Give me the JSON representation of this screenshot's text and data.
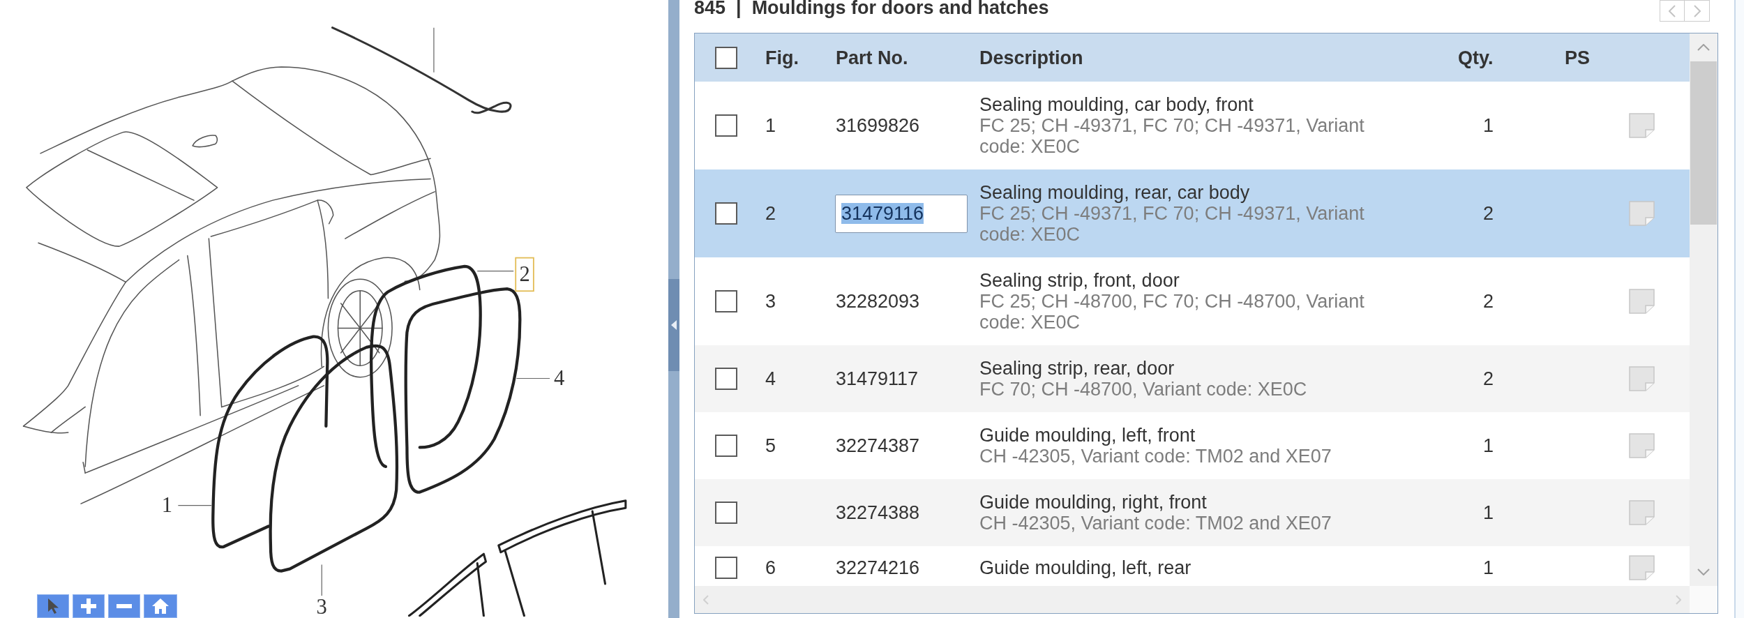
{
  "drawing": {
    "callouts": [
      {
        "label": "1",
        "selected": false
      },
      {
        "label": "2",
        "selected": true
      },
      {
        "label": "3",
        "selected": false
      },
      {
        "label": "4",
        "selected": false
      }
    ]
  },
  "header": {
    "number": "845",
    "separator": "|",
    "title": "Mouldings for doors and hatches"
  },
  "table": {
    "select_all_checked": false,
    "columns": [
      "Fig.",
      "Part No.",
      "Description",
      "Qty.",
      "PS"
    ],
    "rows": [
      {
        "fig": "1",
        "part_no": "31699826",
        "description": "Sealing moulding, car body, front",
        "details": "FC 25; CH -49371, FC 70; CH -49371, Variant code: XE0C",
        "qty": "1",
        "checked": false,
        "selected": false,
        "editing": false
      },
      {
        "fig": "2",
        "part_no": "31479116",
        "description": "Sealing moulding, rear, car body",
        "details": "FC 25; CH -49371, FC 70; CH -49371, Variant code: XE0C",
        "qty": "2",
        "checked": false,
        "selected": true,
        "editing": true
      },
      {
        "fig": "3",
        "part_no": "32282093",
        "description": "Sealing strip, front, door",
        "details": "FC 25; CH -48700, FC 70; CH -48700, Variant code: XE0C",
        "qty": "2",
        "checked": false,
        "selected": false,
        "editing": false
      },
      {
        "fig": "4",
        "part_no": "31479117",
        "description": "Sealing strip, rear, door",
        "details": "FC 70; CH -48700, Variant code: XE0C",
        "qty": "2",
        "checked": false,
        "selected": false,
        "editing": false
      },
      {
        "fig": "5",
        "part_no": "32274387",
        "description": "Guide moulding, left, front",
        "details": "CH -42305, Variant code: TM02 and XE07",
        "qty": "1",
        "checked": false,
        "selected": false,
        "editing": false
      },
      {
        "part_no": "32274388",
        "description": "Guide moulding, right, front",
        "details": "CH -42305, Variant code: TM02 and XE07",
        "qty": "1",
        "checked": false,
        "selected": false,
        "editing": false
      },
      {
        "fig": "6",
        "part_no": "32274216",
        "description": "Guide moulding, left, rear",
        "qty": "1",
        "checked": false,
        "selected": false,
        "editing": false
      }
    ]
  }
}
